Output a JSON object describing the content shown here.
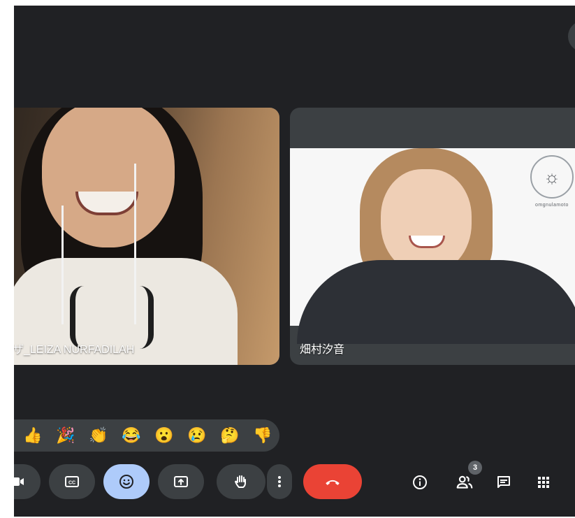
{
  "participants": [
    {
      "name": "ザ_LEIZA NURFADILAH"
    },
    {
      "name": "畑村汐音"
    }
  ],
  "logo_text": "omgnulamoto",
  "reactions": [
    "👍",
    "🎉",
    "👏",
    "😂",
    "😮",
    "😢",
    "🤔",
    "👎"
  ],
  "reaction_icons": [
    "thumbs-up-icon",
    "party-popper-icon",
    "clapping-icon",
    "laughing-icon",
    "surprised-icon",
    "crying-icon",
    "thinking-icon",
    "thumbs-down-icon"
  ],
  "controls": {
    "camera_icon": "camera-icon",
    "captions_icon": "closed-captions-icon",
    "emoji_icon": "emoji-reaction-icon",
    "present_icon": "present-screen-icon",
    "hand_icon": "raise-hand-icon",
    "more_icon": "more-options-icon",
    "end_call_icon": "end-call-icon",
    "end_call_color": "#ea4335",
    "emoji_active_color": "#aecbfa"
  },
  "right_controls": {
    "info_icon": "info-icon",
    "people_icon": "people-icon",
    "people_count": "3",
    "chat_icon": "chat-icon",
    "activities_icon": "apps-grid-icon"
  },
  "colors": {
    "background": "#202124",
    "control_bg": "#3c4043"
  }
}
